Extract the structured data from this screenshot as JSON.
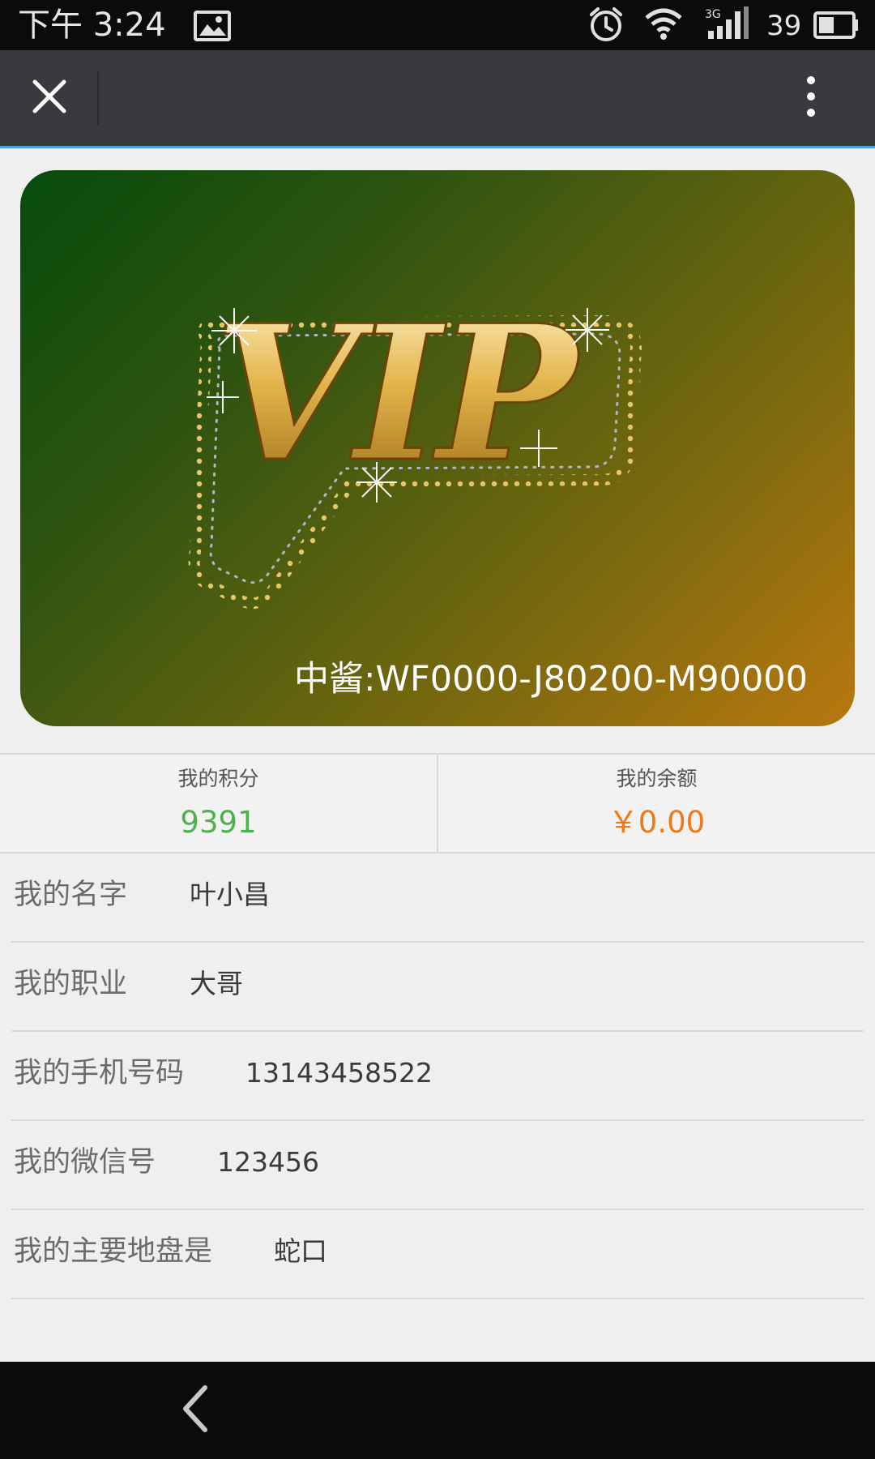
{
  "status_bar": {
    "time": "下午 3:24",
    "battery": "39",
    "icons": [
      "image-icon",
      "alarm-icon",
      "wifi-icon",
      "signal-3g-icon",
      "battery-icon"
    ]
  },
  "action_bar": {
    "close_icon": "close-icon",
    "more_icon": "more-vert-icon"
  },
  "card": {
    "logo_text": "VIP",
    "card_id": "中酱:WF0000-J80200-M90000"
  },
  "stats": {
    "points_label": "我的积分",
    "points_value": "9391",
    "balance_label": "我的余额",
    "balance_value": "￥0.00",
    "points_color": "#4fb04d",
    "balance_color": "#ec7a1c"
  },
  "info": [
    {
      "label": "我的名字",
      "value": "叶小昌"
    },
    {
      "label": "我的职业",
      "value": "大哥"
    },
    {
      "label": "我的手机号码",
      "value": "13143458522"
    },
    {
      "label": "我的微信号",
      "value": "123456"
    },
    {
      "label": "我的主要地盘是",
      "value": "蛇口"
    }
  ],
  "nav_bar": {
    "back_icon": "back-arrow-icon"
  }
}
